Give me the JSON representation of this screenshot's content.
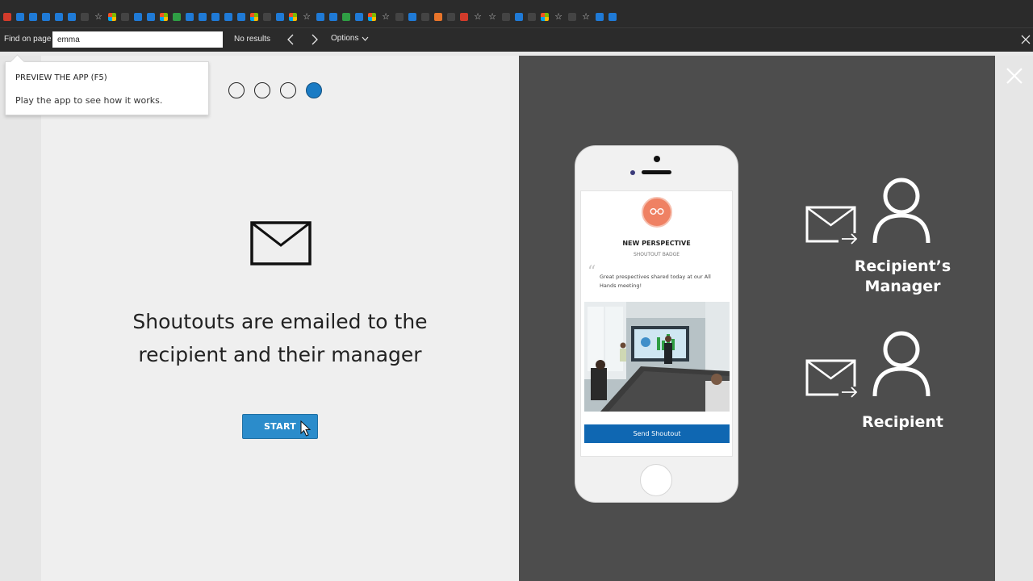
{
  "findbar": {
    "label": "Find on page",
    "query": "emma",
    "status": "No results",
    "options_label": "Options"
  },
  "tooltip": {
    "title": "PREVIEW THE APP (F5)",
    "body": "Play the app to see how it works."
  },
  "steps": {
    "total": 4,
    "active_index": 3
  },
  "main": {
    "headline_line1": "Shoutouts are emailed to the",
    "headline_line2": "recipient and their manager",
    "start_label": "START"
  },
  "phone_card": {
    "title": "NEW PERSPECTIVE",
    "subtitle": "SHOUTOUT BADGE",
    "quote": "Great prespectives shared today at our All Hands meeting!",
    "send_label": "Send Shoutout"
  },
  "recipients": {
    "manager_line1": "Recipient’s",
    "manager_line2": "Manager",
    "recipient": "Recipient"
  },
  "colors": {
    "accent_blue": "#2b8ccb",
    "dark_panel": "#4d4d4d",
    "badge_coral": "#ef8163",
    "send_blue": "#0f67b2"
  },
  "icons": {
    "mail": "mail-icon",
    "person": "person-icon",
    "close": "close-icon",
    "chevron_left": "chevron-left-icon",
    "chevron_right": "chevron-right-icon",
    "chevron_down": "chevron-down-icon",
    "glasses": "glasses-icon"
  }
}
